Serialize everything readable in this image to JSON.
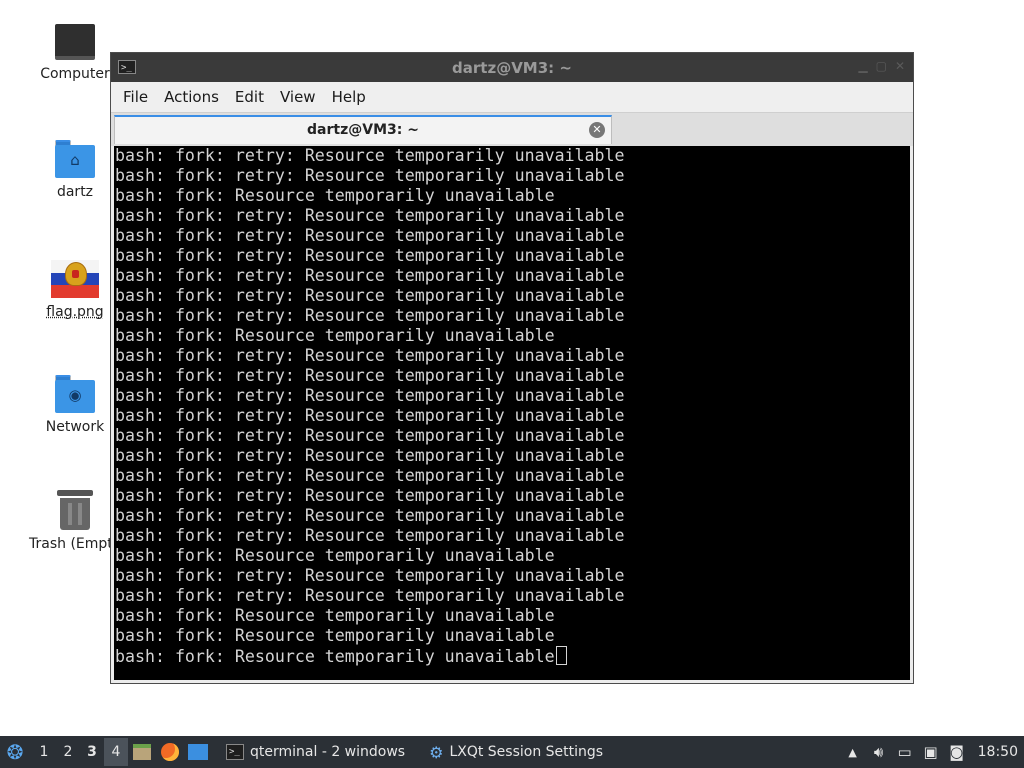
{
  "desktop": {
    "icons": [
      {
        "label": "Computer"
      },
      {
        "label": "dartz"
      },
      {
        "label": "flag.png"
      },
      {
        "label": "Network"
      },
      {
        "label": "Trash (Empty)"
      }
    ]
  },
  "window": {
    "title": "dartz@VM3: ~",
    "menu": [
      "File",
      "Actions",
      "Edit",
      "View",
      "Help"
    ],
    "tab_title": "dartz@VM3: ~",
    "terminal_lines": [
      "bash: fork: retry: Resource temporarily unavailable",
      "bash: fork: retry: Resource temporarily unavailable",
      "bash: fork: Resource temporarily unavailable",
      "bash: fork: retry: Resource temporarily unavailable",
      "bash: fork: retry: Resource temporarily unavailable",
      "bash: fork: retry: Resource temporarily unavailable",
      "bash: fork: retry: Resource temporarily unavailable",
      "bash: fork: retry: Resource temporarily unavailable",
      "bash: fork: retry: Resource temporarily unavailable",
      "bash: fork: Resource temporarily unavailable",
      "bash: fork: retry: Resource temporarily unavailable",
      "bash: fork: retry: Resource temporarily unavailable",
      "bash: fork: retry: Resource temporarily unavailable",
      "bash: fork: retry: Resource temporarily unavailable",
      "bash: fork: retry: Resource temporarily unavailable",
      "bash: fork: retry: Resource temporarily unavailable",
      "bash: fork: retry: Resource temporarily unavailable",
      "bash: fork: retry: Resource temporarily unavailable",
      "bash: fork: retry: Resource temporarily unavailable",
      "bash: fork: retry: Resource temporarily unavailable",
      "bash: fork: Resource temporarily unavailable",
      "bash: fork: retry: Resource temporarily unavailable",
      "bash: fork: retry: Resource temporarily unavailable",
      "bash: fork: Resource temporarily unavailable",
      "bash: fork: Resource temporarily unavailable",
      "bash: fork: Resource temporarily unavailable"
    ]
  },
  "taskbar": {
    "desktops": [
      "1",
      "2",
      "3",
      "4"
    ],
    "tasks": [
      {
        "label": "qterminal - 2 windows",
        "icon": "terminal-icon"
      },
      {
        "label": "LXQt Session Settings",
        "icon": "settings-icon"
      }
    ],
    "clock": "18:50"
  },
  "colors": {
    "terminal_bg": "#000000",
    "terminal_fg": "#d4d4d4",
    "titlebar_bg": "#3a3a3a",
    "taskbar_bg": "#2b3036",
    "accent": "#3a8ee6"
  }
}
